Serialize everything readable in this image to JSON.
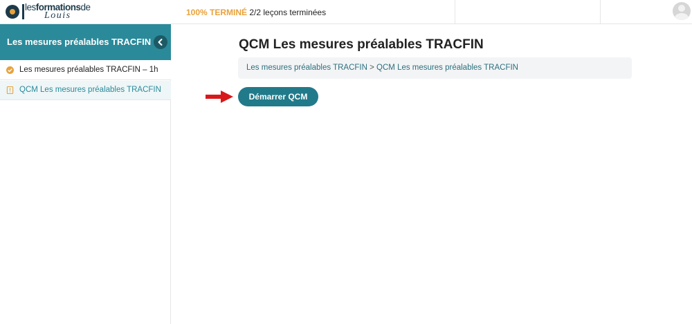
{
  "header": {
    "logo": {
      "text_prefix": "les",
      "text_bold": "formations",
      "text_suffix": "de",
      "script": "Louis"
    },
    "progress": {
      "percent_label": "100% TERMINÉ",
      "lessons_label": "2/2 leçons terminées",
      "percent_value": 100
    },
    "avatar_icon": "user-avatar-icon"
  },
  "sidebar": {
    "title": "Les mesures préalables TRACFIN",
    "collapse_icon": "chevron-left-icon",
    "items": [
      {
        "label": "Les mesures préalables TRACFIN – 1h",
        "icon": "check-circle-icon",
        "status": "completed"
      },
      {
        "label": "QCM Les mesures préalables TRACFIN",
        "icon": "quiz-doc-icon",
        "status": "active"
      }
    ]
  },
  "main": {
    "title": "QCM Les mesures préalables TRACFIN",
    "breadcrumb": {
      "parent": "Les mesures préalables TRACFIN",
      "separator": ">",
      "current": "QCM Les mesures préalables TRACFIN"
    },
    "start_button": "Démarrer QCM",
    "annotation_icon": "red-arrow-icon"
  },
  "colors": {
    "accent": "#2a8a9a",
    "button": "#217a8a",
    "progress": "#e8a23b",
    "arrow": "#d7191c"
  }
}
